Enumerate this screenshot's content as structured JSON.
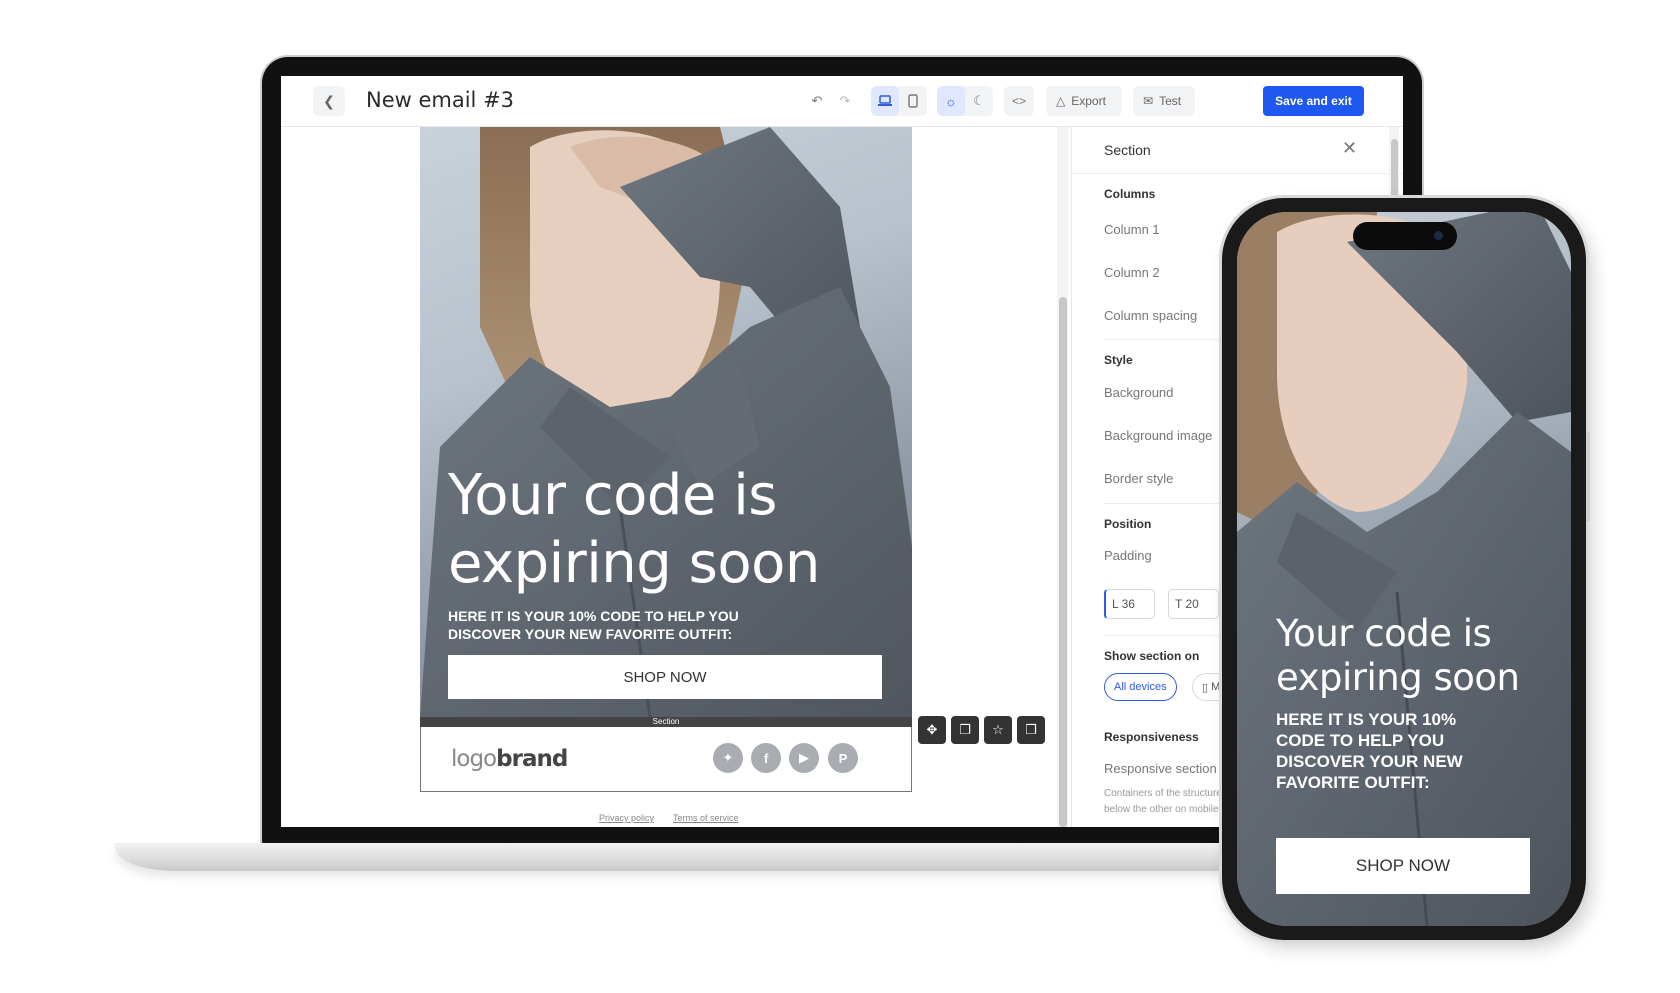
{
  "editor": {
    "title": "New email #3",
    "toolbar": {
      "export_label": "Export",
      "test_label": "Test",
      "save_label": "Save and exit"
    }
  },
  "email": {
    "headline": "Your code is expiring soon",
    "subtext": "HERE IT IS YOUR 10% CODE TO HELP YOU DISCOVER YOUR NEW FAVORITE OUTFIT:",
    "cta": "SHOP NOW",
    "section_tag": "Section",
    "logo_light": "logo",
    "logo_bold": "brand",
    "footer_links": [
      "Privacy policy",
      "Terms of service"
    ]
  },
  "panel": {
    "title": "Section",
    "columns_heading": "Columns",
    "column1": "Column 1",
    "column2": "Column 2",
    "column_spacing": "Column spacing",
    "style_heading": "Style",
    "background": "Background",
    "background_image": "Background image",
    "border_style": "Border style",
    "position_heading": "Position",
    "padding": "Padding",
    "padding_left": "L 36",
    "padding_top": "T 20",
    "show_on_heading": "Show section on",
    "show_all_devices": "All devices",
    "show_mobile": "M",
    "responsiveness_heading": "Responsiveness",
    "responsive_section": "Responsive section",
    "responsive_note_1": "Containers of the structure",
    "responsive_note_2": "below the other on mobile"
  },
  "mobile": {
    "headline": "Your code is expiring soon",
    "subtext": "HERE IT IS YOUR 10% CODE TO HELP YOU DISCOVER YOUR NEW FAVORITE OUTFIT:",
    "cta": "SHOP NOW"
  },
  "colors": {
    "accent": "#1f58f0",
    "canvas": "#ffffff",
    "footer_icon": "#a9acb1"
  }
}
